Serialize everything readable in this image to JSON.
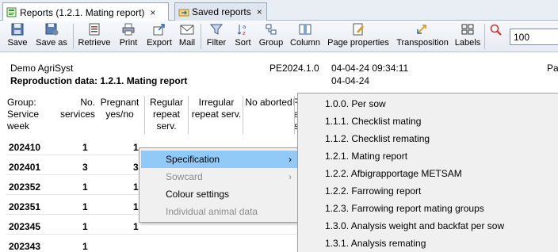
{
  "tabs": [
    {
      "label": "Reports (1.2.1. Mating report)",
      "close": "×"
    },
    {
      "label": "Saved reports",
      "close": "×"
    }
  ],
  "toolbar": {
    "save": "Save",
    "save_as": "Save as",
    "retrieve": "Retrieve",
    "print": "Print",
    "export": "Export",
    "mail": "Mail",
    "filter": "Filter",
    "sort": "Sort",
    "group": "Group",
    "column": "Column",
    "page_properties": "Page properties",
    "transposition": "Transposition",
    "labels": "Labels",
    "zoom_value": "100"
  },
  "report": {
    "company": "Demo AgriSyst",
    "title": "Reproduction data: 1.2.1. Mating report",
    "code": "PE2024.1.0",
    "datetime": "04-04-24 09:34:11",
    "date": "04-04-24",
    "page_label": "Pa",
    "columns": [
      "Group:\nService\nweek",
      "No.\nservices",
      "Pregnant\nyes/no",
      "Regular\nrepeat\nserv.",
      "Irregular\nrepeat serv.",
      "No aborted",
      "R\na\ns"
    ],
    "rows": [
      {
        "week": "202410",
        "services": "1",
        "pregnant": "1"
      },
      {
        "week": "202401",
        "services": "3",
        "pregnant": "3"
      },
      {
        "week": "202352",
        "services": "1",
        "pregnant": "1"
      },
      {
        "week": "202351",
        "services": "1",
        "pregnant": "1"
      },
      {
        "week": "202345",
        "services": "1",
        "pregnant": "1"
      },
      {
        "week": "202343",
        "services": "1",
        "pregnant": ""
      }
    ]
  },
  "context_menu": {
    "items": [
      {
        "label": "Specification",
        "arrow": "›"
      },
      {
        "label": "Sowcard",
        "arrow": "›"
      },
      {
        "label": "Colour settings",
        "arrow": ""
      },
      {
        "label": "Individual animal data",
        "arrow": ""
      }
    ]
  },
  "submenu": {
    "items": [
      "1.0.0. Per sow",
      "1.1.1. Checklist mating",
      "1.1.2. Checklist remating",
      "1.2.1. Mating report",
      "1.2.2. Afbigrapportage METSAM",
      "1.2.2. Farrowing report",
      "1.2.3. Farrowing report mating groups",
      "1.3.0. Analysis weight and backfat per sow",
      "1.3.1. Analysis remating"
    ]
  },
  "colors": {
    "highlight": "#91c9f7",
    "menu_bg": "#f0f0f0",
    "toolbar_bg": "#e6ebf2"
  },
  "icons": {
    "save": "floppy-disk-icon",
    "save_as": "floppy-disk-plus-icon",
    "retrieve": "list-document-icon",
    "print": "printer-icon",
    "export": "export-arrow-icon",
    "mail": "envelope-icon",
    "filter": "funnel-icon",
    "sort": "sort-az-icon",
    "group": "group-blocks-icon",
    "column": "columns-icon",
    "page_properties": "page-pencil-icon",
    "transposition": "transpose-icon",
    "labels": "label-grid-icon",
    "zoom": "zoom-magnifier-icon"
  }
}
